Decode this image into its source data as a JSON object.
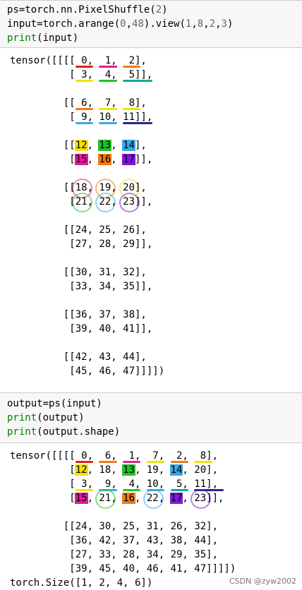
{
  "cell1": {
    "lines": [
      "ps=torch.nn.PixelShuffle(2)",
      "input=torch.arange(0,48).view(1,8,2,3)",
      "print(input)"
    ]
  },
  "out1": {
    "lines": [
      "tensor([[[[ 0,  1,  2],",
      "          [ 3,  4,  5]],",
      "",
      "         [[ 6,  7,  8],",
      "          [ 9, 10, 11]],",
      "",
      "         [[12, 13, 14],",
      "          [15, 16, 17]],",
      "",
      "         [[18, 19, 20],",
      "          [21, 22, 23]],",
      "",
      "         [[24, 25, 26],",
      "          [27, 28, 29]],",
      "",
      "         [[30, 31, 32],",
      "          [33, 34, 35]],",
      "",
      "         [[36, 37, 38],",
      "          [39, 40, 41]],",
      "",
      "         [[42, 43, 44],",
      "          [45, 46, 47]]]])"
    ]
  },
  "cell2": {
    "lines": [
      "output=ps(input)",
      "print(output)",
      "print(output.shape)"
    ]
  },
  "out2": {
    "lines": [
      "tensor([[[[ 0,  6,  1,  7,  2,  8],",
      "          [12, 18, 13, 19, 14, 20],",
      "          [ 3,  9,  4, 10,  5, 11],",
      "          [15, 21, 16, 22, 17, 23]],",
      "",
      "         [[24, 30, 25, 31, 26, 32],",
      "          [36, 42, 37, 43, 38, 44],",
      "          [27, 33, 28, 34, 29, 35],",
      "          [39, 45, 40, 46, 41, 47]]]])",
      "torch.Size([1, 2, 4, 6])"
    ]
  },
  "watermark": "CSDN @zyw2002",
  "colors": {
    "red": "#e0201a",
    "pink": "#e0208a",
    "yellow": "#f3e10a",
    "green": "#22c12a",
    "blue": "#38a8e8",
    "orange": "#f07a16",
    "purple": "#7e18d8",
    "magenta": "#e1189c",
    "navy": "#222a8a",
    "teal": "#18a890"
  }
}
